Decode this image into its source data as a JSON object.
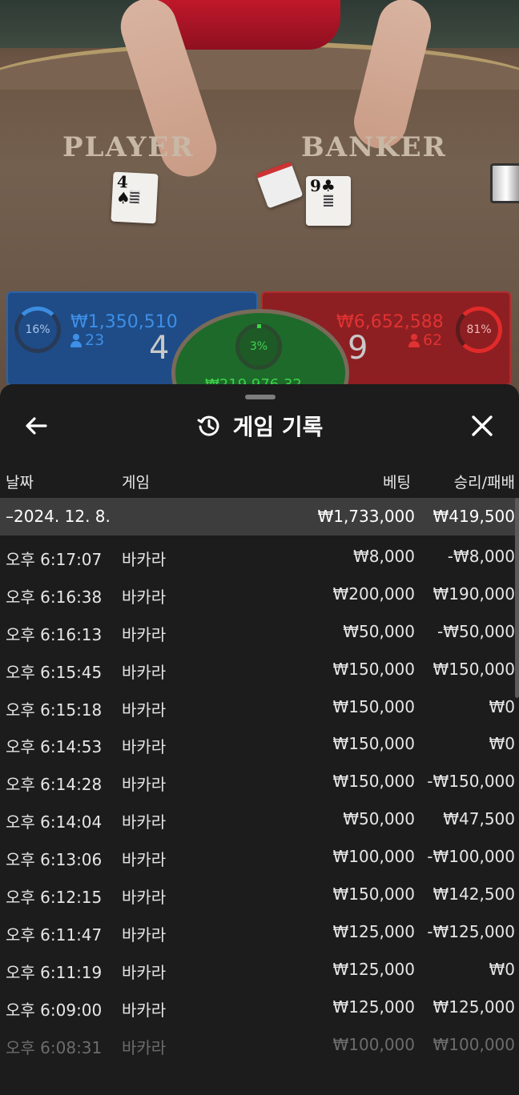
{
  "table": {
    "player_label": "PLAYER",
    "banker_label": "BANKER",
    "player_card": {
      "rank": "4",
      "suit": "♠"
    },
    "banker_card": {
      "rank": "9",
      "suit": "♣"
    }
  },
  "stats": {
    "player": {
      "percent": "16%",
      "amount": "₩1,350,510",
      "count": "23",
      "score": "4",
      "color": "#3d8fe8"
    },
    "banker": {
      "percent": "81%",
      "amount": "₩6,652,588",
      "count": "62",
      "score": "9",
      "color": "#e03232"
    },
    "tie": {
      "percent": "3%",
      "amount": "₩219,976.32",
      "color": "#3dd34a"
    }
  },
  "history": {
    "title": "게임 기록",
    "columns": {
      "date": "날짜",
      "game": "게임",
      "bet": "베팅",
      "winloss": "승리/패배"
    },
    "group": {
      "date": "–2024. 12. 8.",
      "bet": "₩1,733,000",
      "winloss": "₩419,500"
    },
    "rows": [
      {
        "time": "오후 6:17:07",
        "game": "바카라",
        "bet": "₩8,000",
        "winloss": "-₩8,000"
      },
      {
        "time": "오후 6:16:38",
        "game": "바카라",
        "bet": "₩200,000",
        "winloss": "₩190,000"
      },
      {
        "time": "오후 6:16:13",
        "game": "바카라",
        "bet": "₩50,000",
        "winloss": "-₩50,000"
      },
      {
        "time": "오후 6:15:45",
        "game": "바카라",
        "bet": "₩150,000",
        "winloss": "₩150,000"
      },
      {
        "time": "오후 6:15:18",
        "game": "바카라",
        "bet": "₩150,000",
        "winloss": "₩0"
      },
      {
        "time": "오후 6:14:53",
        "game": "바카라",
        "bet": "₩150,000",
        "winloss": "₩0"
      },
      {
        "time": "오후 6:14:28",
        "game": "바카라",
        "bet": "₩150,000",
        "winloss": "-₩150,000"
      },
      {
        "time": "오후 6:14:04",
        "game": "바카라",
        "bet": "₩50,000",
        "winloss": "₩47,500"
      },
      {
        "time": "오후 6:13:06",
        "game": "바카라",
        "bet": "₩100,000",
        "winloss": "-₩100,000"
      },
      {
        "time": "오후 6:12:15",
        "game": "바카라",
        "bet": "₩150,000",
        "winloss": "₩142,500"
      },
      {
        "time": "오후 6:11:47",
        "game": "바카라",
        "bet": "₩125,000",
        "winloss": "-₩125,000"
      },
      {
        "time": "오후 6:11:19",
        "game": "바카라",
        "bet": "₩125,000",
        "winloss": "₩0"
      },
      {
        "time": "오후 6:09:00",
        "game": "바카라",
        "bet": "₩125,000",
        "winloss": "₩125,000"
      },
      {
        "time": "오후 6:08:31",
        "game": "바카라",
        "bet": "₩100,000",
        "winloss": "₩100,000"
      }
    ]
  },
  "icons": {
    "back": "arrow-left-icon",
    "history": "history-icon",
    "close": "close-icon",
    "user": "user-icon"
  }
}
